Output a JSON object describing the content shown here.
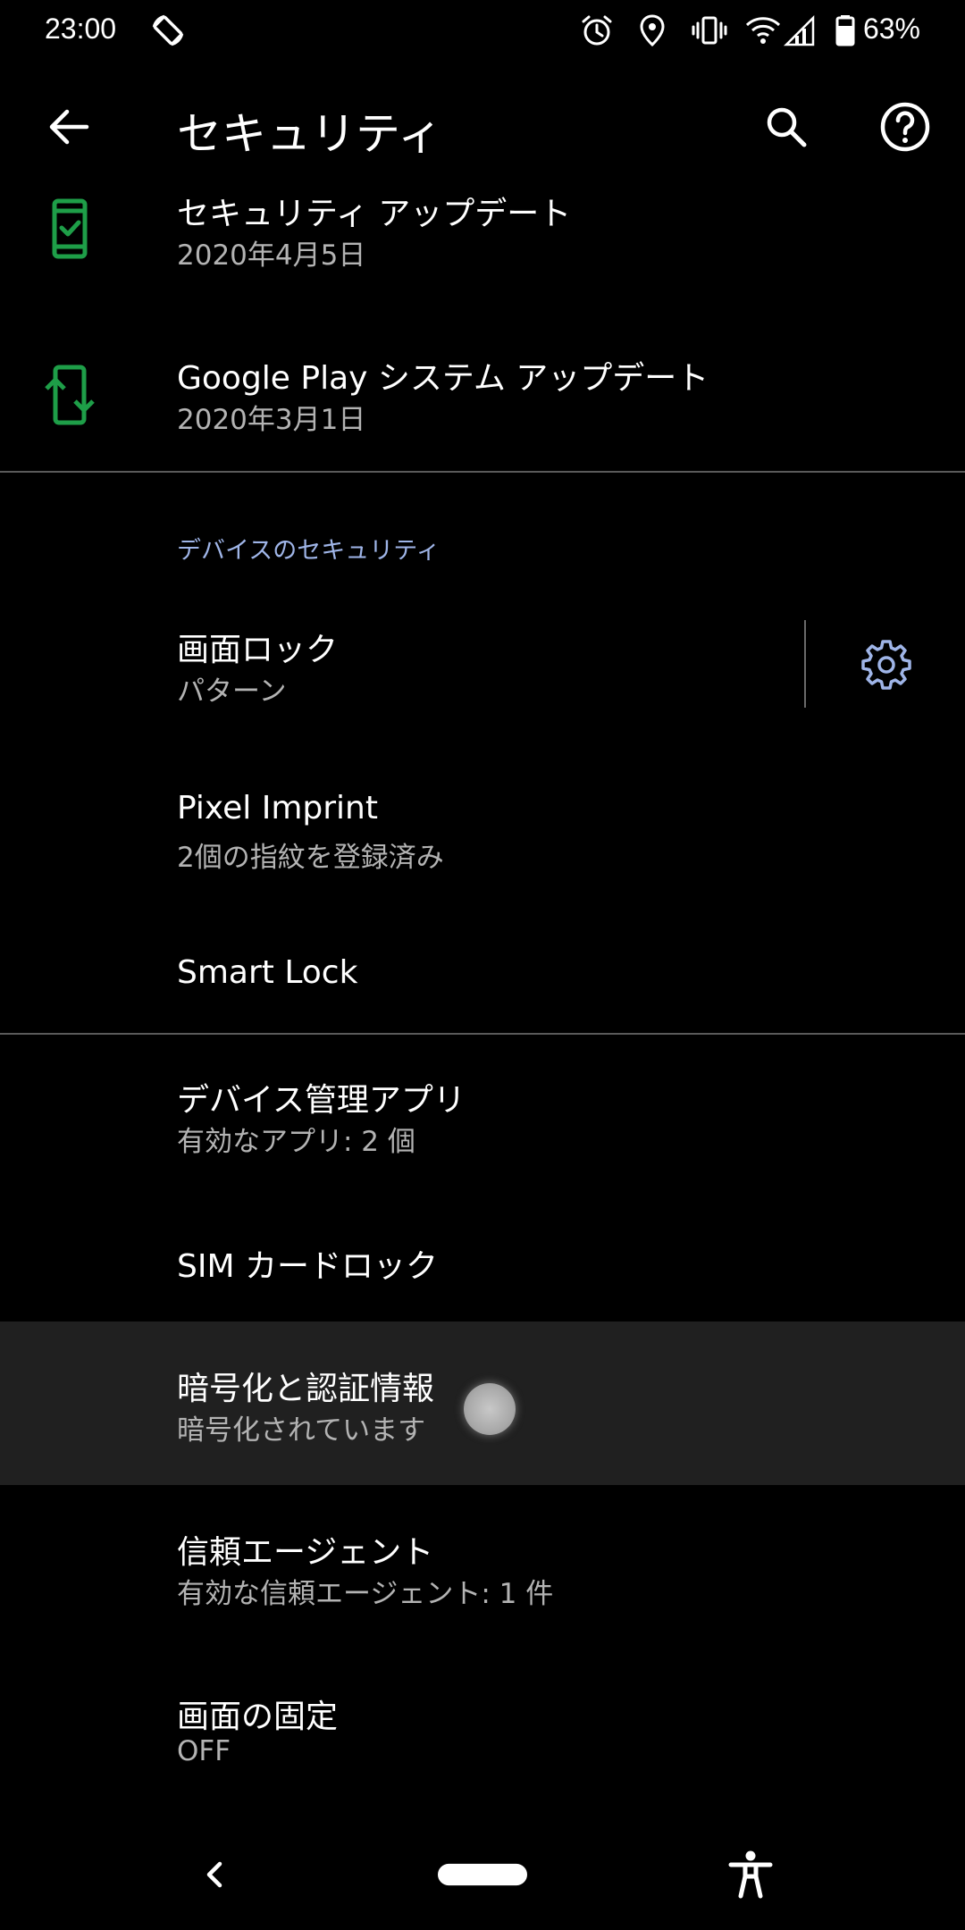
{
  "status_bar": {
    "time": "23:00",
    "battery_percent": "63%",
    "icons": [
      "screen-rotation-icon",
      "alarm-icon",
      "location-icon",
      "vibrate-icon",
      "wifi-icon",
      "signal-icon",
      "battery-icon"
    ]
  },
  "app_bar": {
    "title": "セキュリティ",
    "back_icon": "back-arrow-icon",
    "search_icon": "search-icon",
    "help_icon": "help-icon"
  },
  "updates": [
    {
      "title": "セキュリティ アップデート",
      "summary": "2020年4月5日",
      "icon": "phone-check-icon"
    },
    {
      "title": "Google Play システム アップデート",
      "summary": "2020年3月1日",
      "icon": "system-update-icon"
    }
  ],
  "device_security": {
    "category_title": "デバイスのセキュリティ",
    "screen_lock": {
      "title": "画面ロック",
      "summary": "パターン",
      "settings_icon": "gear-icon"
    },
    "pixel_imprint": {
      "title": "Pixel Imprint",
      "summary": "2個の指紋を登録済み"
    },
    "smart_lock": {
      "title": "Smart Lock"
    }
  },
  "advanced": {
    "device_admin": {
      "title": "デバイス管理アプリ",
      "summary": "有効なアプリ: 2 個"
    },
    "sim_lock": {
      "title": "SIM カードロック"
    },
    "encryption": {
      "title": "暗号化と認証情報",
      "summary": "暗号化されています"
    },
    "trust_agents": {
      "title": "信頼エージェント",
      "summary": "有効な信頼エージェント: 1 件"
    },
    "screen_pinning": {
      "title": "画面の固定",
      "summary": "OFF"
    }
  },
  "colors": {
    "background": "#000000",
    "accent_green": "#1e9e48",
    "category_blue": "#9fb5e8",
    "highlight": "#202020"
  },
  "nav_bar": {
    "back_icon": "nav-back-icon",
    "home_icon": "home-pill-icon",
    "accessibility_icon": "accessibility-icon"
  }
}
